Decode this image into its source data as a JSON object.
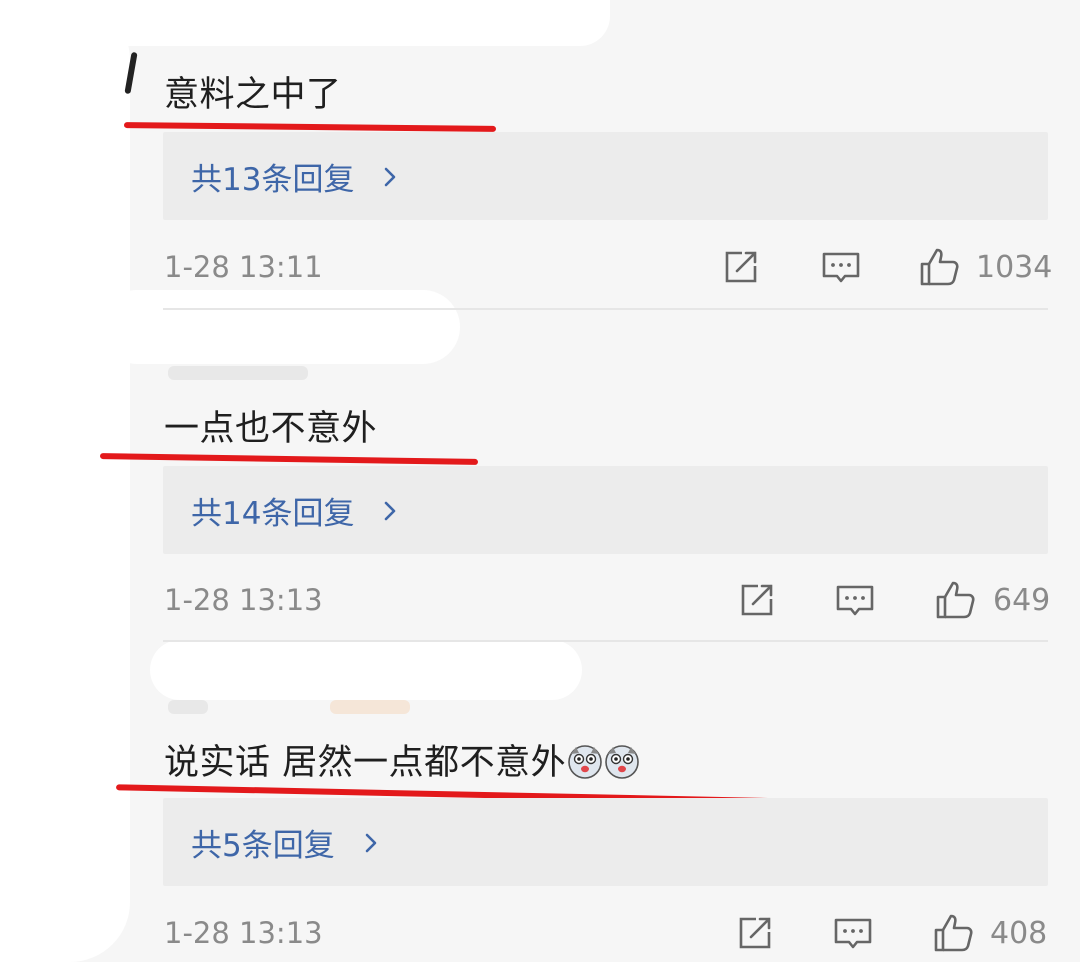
{
  "comments": [
    {
      "text": "意料之中了",
      "reply_label": "共13条回复",
      "timestamp": "1-28 13:11",
      "likes": "1034"
    },
    {
      "text": "一点也不意外",
      "reply_label": "共14条回复",
      "timestamp": "1-28 13:13",
      "likes": "649"
    },
    {
      "text": "说实话 居然一点都不意外",
      "reply_label": "共5条回复",
      "timestamp": "1-28 13:13",
      "likes": "408",
      "emoji": [
        "husky-emoji",
        "husky-emoji"
      ]
    }
  ],
  "colors": {
    "reply_link": "#3e66a8",
    "underline": "#e3191b",
    "meta_text": "#8a8a8a",
    "background": "#f6f6f6"
  },
  "icons": [
    "share-icon",
    "comment-icon",
    "like-icon",
    "chevron-right-icon"
  ]
}
